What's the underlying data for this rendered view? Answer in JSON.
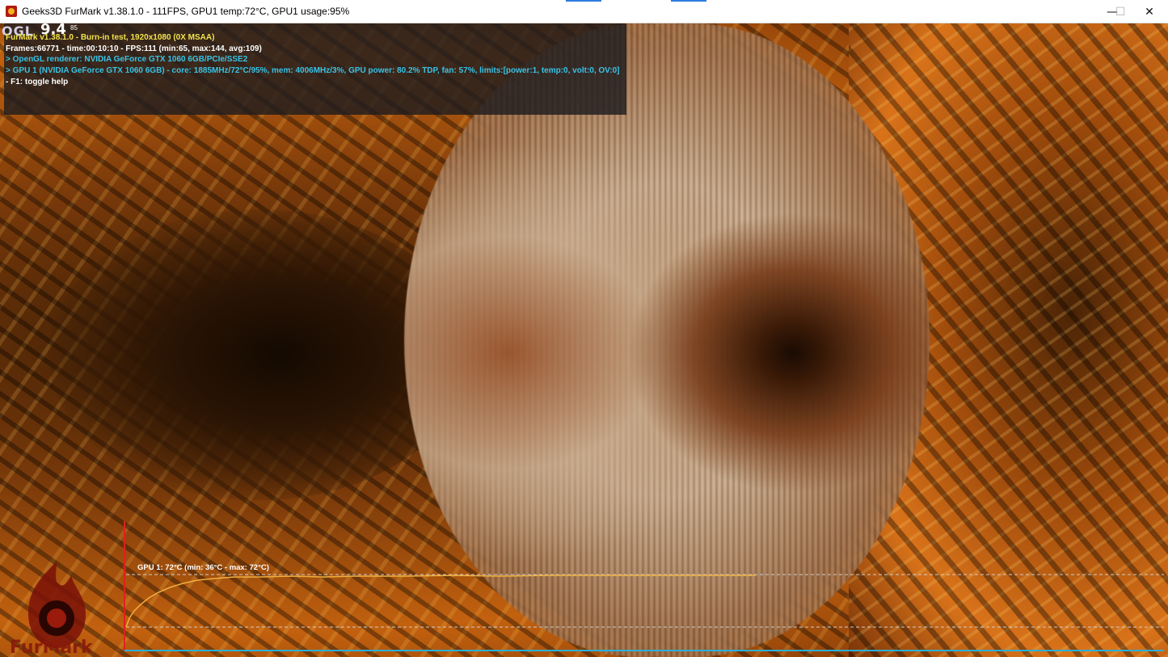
{
  "window": {
    "title": "Geeks3D FurMark v1.38.1.0 - 111FPS, GPU1 temp:72°C, GPU1 usage:95%",
    "icon": "furmark-app-icon",
    "controls": {
      "minimize": "—",
      "maximize": "☐",
      "close": "✕"
    }
  },
  "osd": {
    "api": "OGL",
    "api_version": "9.4",
    "api_version_sub": "85",
    "lines": [
      "FurMark v1.38.1.0 - Burn-in test, 1920x1080 (0X MSAA)",
      "Frames:66771 - time:00:10:10 - FPS:111 (min:65, max:144, avg:109)",
      "> OpenGL renderer: NVIDIA GeForce GTX 1060 6GB/PCIe/SSE2",
      "> GPU 1 (NVIDIA GeForce GTX 1060 6GB) - core: 1885MHz/72°C/95%, mem: 4006MHz/3%, GPU power: 80.2% TDP, fan: 57%, limits:[power:1, temp:0, volt:0, OV:0]",
      "- F1: toggle help"
    ],
    "colors": {
      "title": "#f2e34a",
      "stats": "#ffffff",
      "gpu_info": "#39c3e6",
      "help": "#ffffff"
    }
  },
  "graph": {
    "label": "GPU 1: 72°C (min: 36°C - max: 72°C)",
    "current_temp_c": 72,
    "min_temp_c": 36,
    "max_temp_c": 72,
    "line_color": "#f0b040",
    "axis_color": "#2ab0d8",
    "marker_color": "#e02020"
  },
  "logo": {
    "text": "FurMark",
    "icon": "furmark-flame-logo"
  }
}
